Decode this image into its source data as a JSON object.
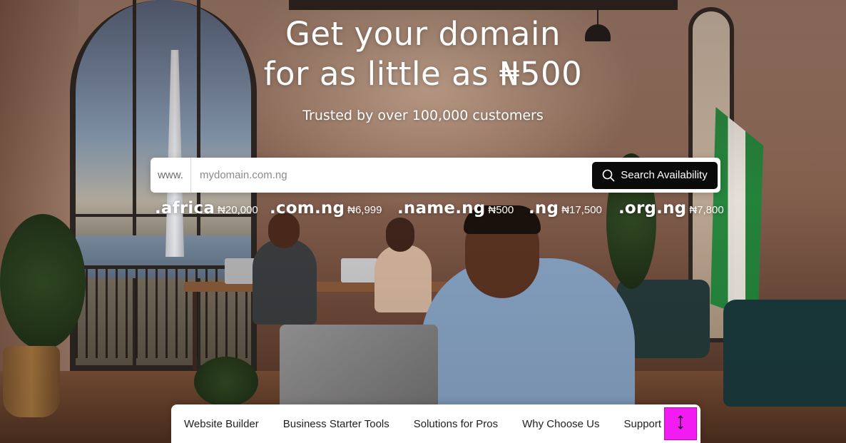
{
  "hero": {
    "title_line1": "Get your domain",
    "title_line2": "for as little as ₦500",
    "subtitle": "Trusted by over 100,000 customers"
  },
  "search": {
    "prefix": "www.",
    "placeholder": "mydomain.com.ng",
    "value": "",
    "button_label": "Search Availability",
    "button_icon": "search-icon"
  },
  "tlds": [
    {
      "ext": ".africa",
      "price": "₦20,000"
    },
    {
      "ext": ".com.ng",
      "price": "₦6,999"
    },
    {
      "ext": ".name.ng",
      "price": "₦500"
    },
    {
      "ext": ".ng",
      "price": "₦17,500"
    },
    {
      "ext": ".org.ng",
      "price": "₦7,800"
    }
  ],
  "nav": {
    "items": [
      {
        "label": "Website Builder"
      },
      {
        "label": "Business Starter Tools"
      },
      {
        "label": "Solutions for Pros"
      },
      {
        "label": "Why Choose Us"
      },
      {
        "label": "Support"
      }
    ],
    "scroll_top_icon": "arrow-up-down-icon"
  },
  "colors": {
    "search_button_bg": "#0a0a0a",
    "scroll_top_bg": "#f21cf2",
    "text_on_image": "#ffffff"
  }
}
